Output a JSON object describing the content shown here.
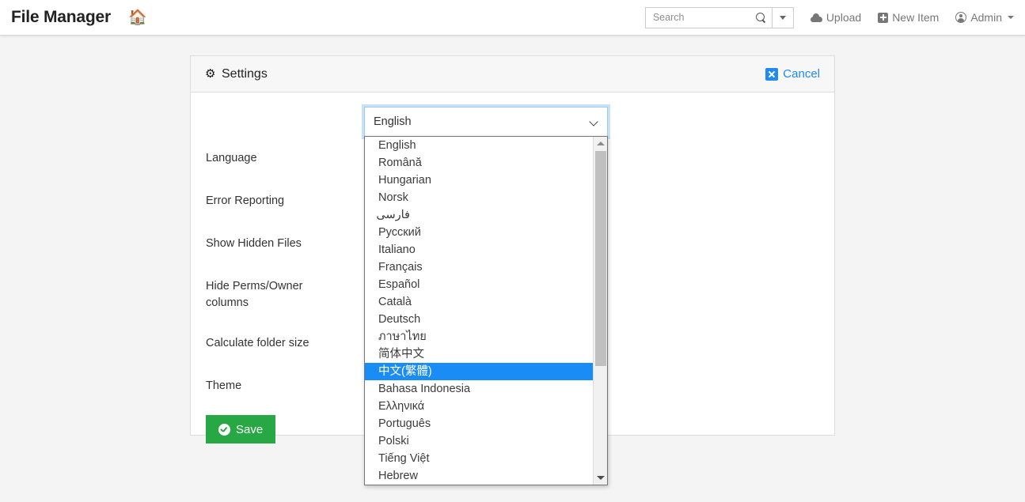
{
  "navbar": {
    "brand": "File Manager",
    "home_icon": "home-icon",
    "search": {
      "placeholder": "Search",
      "value": "",
      "icon": "magnifier-icon",
      "dropdown_icon": "caret-down-icon"
    },
    "links": [
      {
        "label": "Upload",
        "icon": "cloud-upload-icon"
      },
      {
        "label": "New Item",
        "icon": "plus-square-icon"
      },
      {
        "label": "Admin",
        "icon": "user-circle-icon",
        "caret": "caret-down-icon"
      }
    ]
  },
  "panel": {
    "title": "Settings",
    "title_icon": "gear-icon",
    "cancel": {
      "label": "Cancel",
      "icon": "close-square-icon"
    },
    "labels": [
      "Language",
      "Error Reporting",
      "Show Hidden Files",
      "Hide Perms/Owner columns",
      "Calculate folder size",
      "Theme"
    ],
    "save": {
      "label": "Save",
      "icon": "check-circle-icon"
    }
  },
  "language_select": {
    "name": "language-select",
    "selected": "English",
    "chevron_icon": "chevron-down-icon",
    "expanded": true,
    "highlighted_index": 13,
    "options": [
      "English",
      "Română",
      "Hungarian",
      "Norsk",
      "فارسی",
      "Русский",
      "Italiano",
      "Français",
      "Español",
      "Català",
      "Deutsch",
      "ภาษาไทย",
      "简体中文",
      "中文(繁體)",
      "Bahasa Indonesia",
      "Ελληνικά",
      "Português",
      "Polski",
      "Tiếng Việt",
      "Hebrew"
    ],
    "scrollbar": {
      "up_arrow_icon": "scroll-up-arrow-icon",
      "down_arrow_icon": "scroll-down-arrow-icon"
    }
  },
  "colors": {
    "accent_blue": "#2089f4",
    "highlight_blue": "#1a8cf5",
    "save_green": "#28a745",
    "page_bg": "#f4f4f4"
  }
}
